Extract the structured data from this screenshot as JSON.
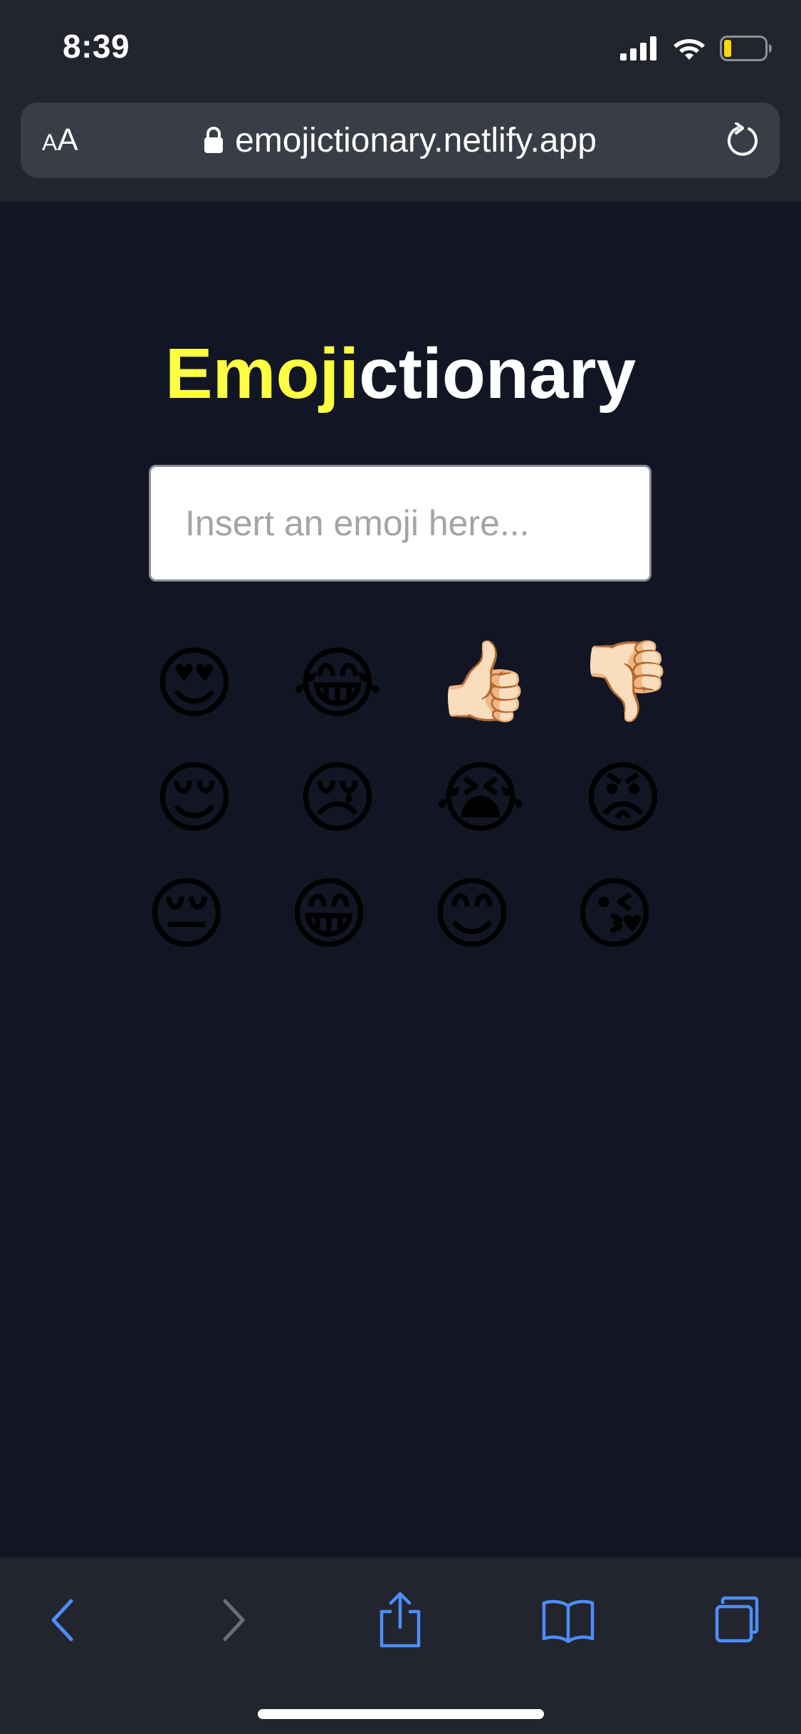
{
  "status_bar": {
    "time": "8:39"
  },
  "browser": {
    "text_size_small": "A",
    "text_size_large": "A",
    "url": "emojictionary.netlify.app"
  },
  "page": {
    "title_accent": "Emoji",
    "title_rest": "ctionary",
    "accent_color": "#ffff44",
    "input_placeholder": "Insert an emoji here...",
    "emojis": [
      {
        "char": "😍",
        "name": "smiling-face-with-heart-eyes"
      },
      {
        "char": "😂",
        "name": "face-with-tears-of-joy"
      },
      {
        "char": "👍🏻",
        "name": "thumbs-up-light-skin-tone"
      },
      {
        "char": "👎🏻",
        "name": "thumbs-down-light-skin-tone"
      },
      {
        "char": "😌",
        "name": "relieved-face"
      },
      {
        "char": "😢",
        "name": "crying-face"
      },
      {
        "char": "😭",
        "name": "loudly-crying-face"
      },
      {
        "char": "😡",
        "name": "pouting-face"
      },
      {
        "char": "😔",
        "name": "pensive-face"
      },
      {
        "char": "😁",
        "name": "beaming-face-with-smiling-eyes"
      },
      {
        "char": "😊",
        "name": "smiling-face-with-smiling-eyes"
      },
      {
        "char": "😘",
        "name": "face-blowing-a-kiss"
      }
    ]
  },
  "toolbar": {
    "icons": [
      "back-icon",
      "forward-icon",
      "share-icon",
      "bookmarks-icon",
      "tabs-icon"
    ]
  }
}
